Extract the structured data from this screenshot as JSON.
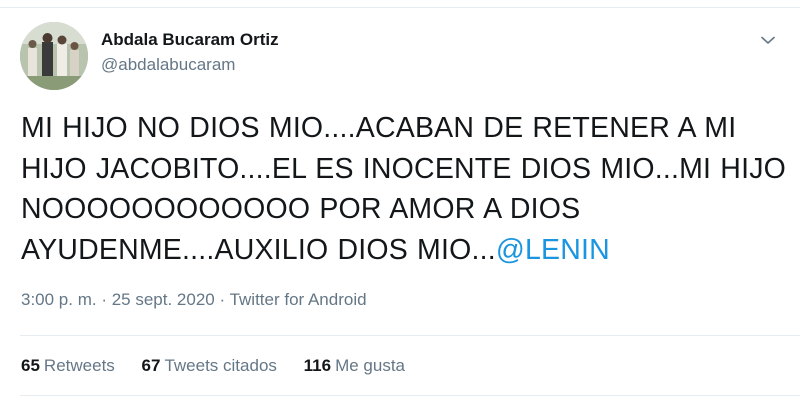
{
  "author": {
    "name": "Abdala Bucaram Ortiz",
    "handle": "@abdalabucaram"
  },
  "tweet": {
    "lines": [
      "MI HIJO NO DIOS MIO....ACABAN DE RETENER A MI",
      "HIJO JACOBITO....EL ES INOCENTE DIOS MIO...MI HIJO",
      "NOOOOOOOOOOOO POR AMOR A DIOS",
      "AYUDENME....AUXILIO DIOS MIO..."
    ],
    "mention": "@LENIN"
  },
  "meta": {
    "time": "3:00 p. m.",
    "separator": " · ",
    "date": "25 sept. 2020",
    "source": "Twitter for Android"
  },
  "stats": {
    "retweets": {
      "count": "65",
      "label": "Retweets"
    },
    "quotes": {
      "count": "67",
      "label": "Tweets citados"
    },
    "likes": {
      "count": "116",
      "label": "Me gusta"
    }
  },
  "icons": {
    "menu": "chevron-down-icon",
    "avatar": "avatar-photo"
  },
  "colors": {
    "text": "#14171a",
    "secondary": "#657786",
    "link": "#1b95e0",
    "divider": "#e6ecf0"
  }
}
